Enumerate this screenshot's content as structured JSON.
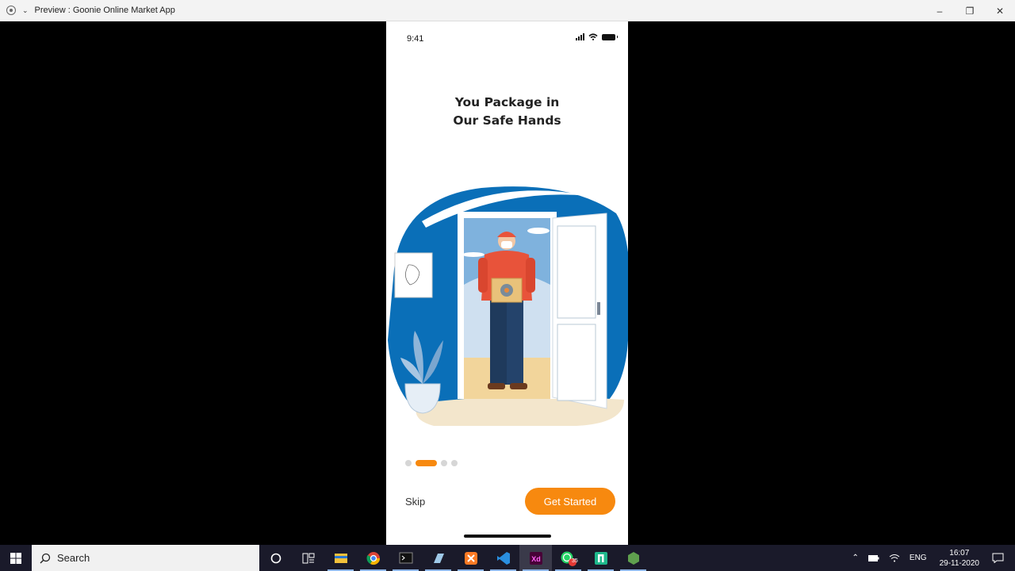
{
  "window": {
    "title": "Preview : Goonie Online Market App"
  },
  "phone": {
    "status_time": "9:41",
    "heading_line1": "You Package in",
    "heading_line2": "Our Safe Hands",
    "pager": {
      "total": 4,
      "active_index": 1
    },
    "skip_label": "Skip",
    "cta_label": "Get Started",
    "colors": {
      "accent": "#f7890f",
      "illustration_blue": "#0a6fb8"
    }
  },
  "taskbar": {
    "search_placeholder": "Search",
    "apps": [
      "cortana-icon",
      "task-view-icon",
      "file-explorer-icon",
      "chrome-icon",
      "terminal-icon",
      "notes-icon",
      "xampp-icon",
      "vscode-icon",
      "adobe-xd-icon",
      "whatsapp-icon",
      "app-icon",
      "node-icon"
    ],
    "whatsapp_badge": "35",
    "language": "ENG",
    "time": "16:07",
    "date": "29-11-2020"
  }
}
